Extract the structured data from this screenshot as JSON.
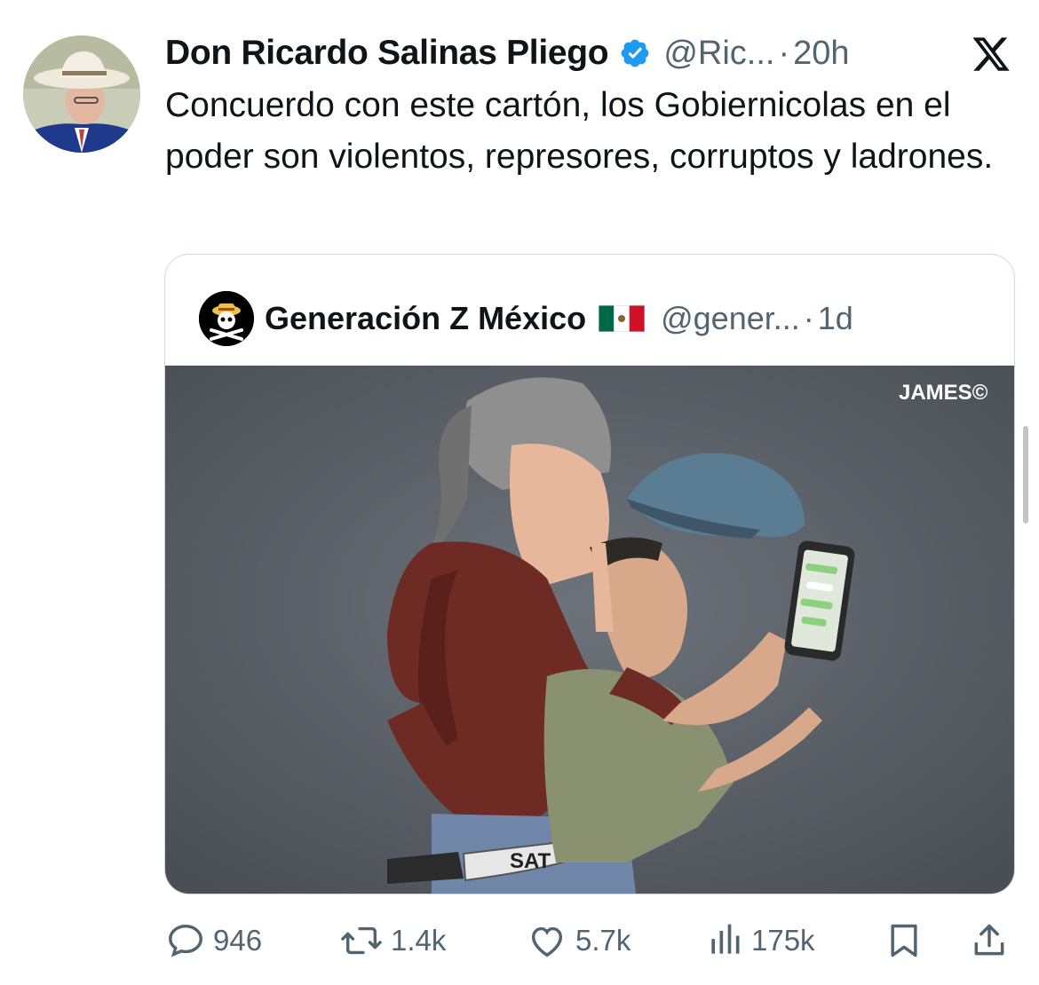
{
  "tweet": {
    "author_name": "Don Ricardo Salinas Pliego",
    "handle": "@Ric...",
    "separator": "·",
    "time": "20h",
    "text": "Concuerdo con este cartón, los Gobiernicolas en el poder son violentos, represores, corruptos y ladrones."
  },
  "quote": {
    "author_name": "Generación Z México",
    "handle": "@gener...",
    "separator": "·",
    "time": "1d",
    "image": {
      "signature": "JAMES©",
      "knife_label": "SAT"
    }
  },
  "actions": {
    "replies": "946",
    "reposts": "1.4k",
    "likes": "5.7k",
    "views": "175k"
  },
  "colors": {
    "text": "#0f1419",
    "secondary": "#536471",
    "verified": "#1d9bf0",
    "border": "#cfd9de"
  },
  "icons": [
    "verified-badge-icon",
    "x-logo-icon",
    "mexico-flag-icon",
    "reply-icon",
    "repost-icon",
    "like-icon",
    "views-icon",
    "bookmark-icon",
    "share-icon"
  ]
}
